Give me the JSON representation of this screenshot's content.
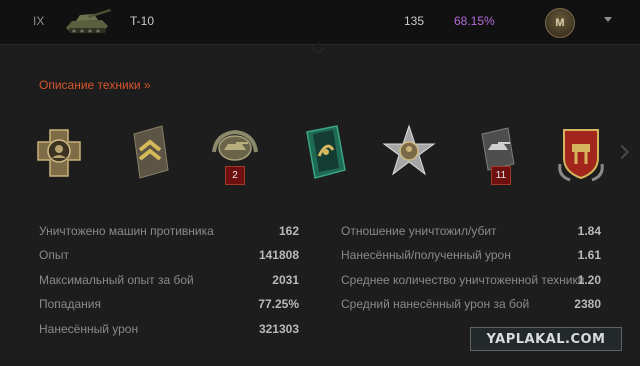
{
  "header": {
    "tier": "IX",
    "tank_name": "T-10",
    "battles": "135",
    "win_rate": "68.15%",
    "mastery_letter": "M"
  },
  "description_link": "Описание техники »",
  "medals": [
    {
      "name": "cross-medal",
      "badge": null
    },
    {
      "name": "chevron-medal",
      "badge": null
    },
    {
      "name": "tank-wreath-medal",
      "badge": "2"
    },
    {
      "name": "green-ribbon-medal",
      "badge": null
    },
    {
      "name": "star-portrait-medal",
      "badge": null
    },
    {
      "name": "tank-ribbon-medal",
      "badge": "11"
    },
    {
      "name": "red-shield-medal",
      "badge": null
    }
  ],
  "stats_left": [
    {
      "label": "Уничтожено машин противника",
      "value": "162"
    },
    {
      "label": "Опыт",
      "value": "141808"
    },
    {
      "label": "Максимальный опыт за бой",
      "value": "2031"
    },
    {
      "label": "Попадания",
      "value": "77.25%"
    },
    {
      "label": "Нанесённый урон",
      "value": "321303"
    }
  ],
  "stats_right": [
    {
      "label": "Отношение уничтожил/убит",
      "value": "1.84"
    },
    {
      "label": "Нанесённый/полученный урон",
      "value": "1.61"
    },
    {
      "label": "Среднее количество уничтоженной техники",
      "value": "1.20"
    },
    {
      "label": "Средний нанесённый урон за бой",
      "value": "2380"
    }
  ],
  "watermark": "YAPLAKAL.COM",
  "colors": {
    "accent": "#d9542b",
    "win_rate": "#b56ad8"
  }
}
